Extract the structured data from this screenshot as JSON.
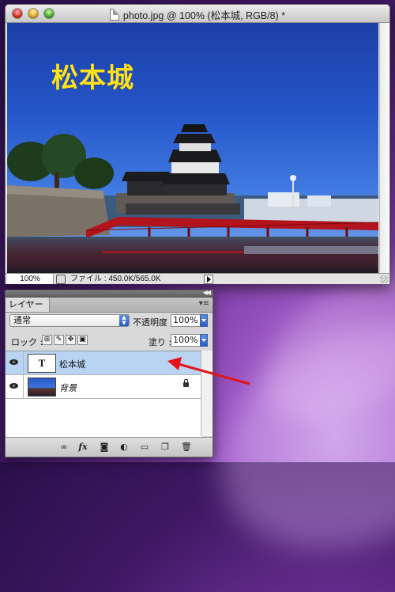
{
  "document": {
    "title": "photo.jpg @ 100% (松本城, RGB/8) *",
    "photo_caption": "松本城",
    "zoom": "100%",
    "file_info": "ファイル : 450.0K/565.0K"
  },
  "layers_panel": {
    "tab_label": "レイヤー",
    "blend_mode": "通常",
    "opacity_label": "不透明度 :",
    "opacity_value": "100%",
    "lock_label": "ロック :",
    "fill_label": "塗り :",
    "fill_value": "100%",
    "layers": [
      {
        "name": "松本城",
        "thumb_text": "T",
        "selected": true
      },
      {
        "name": "背景",
        "selected": false,
        "locked": true
      }
    ],
    "bottom_icons": [
      "link-icon",
      "fx-icon",
      "mask-icon",
      "adjustment-icon",
      "group-folder-icon",
      "new-layer-icon",
      "trash-icon"
    ]
  },
  "colors": {
    "caption": "#ffe21a",
    "selection": "#b8d4f2",
    "arrow": "#e3151a"
  }
}
